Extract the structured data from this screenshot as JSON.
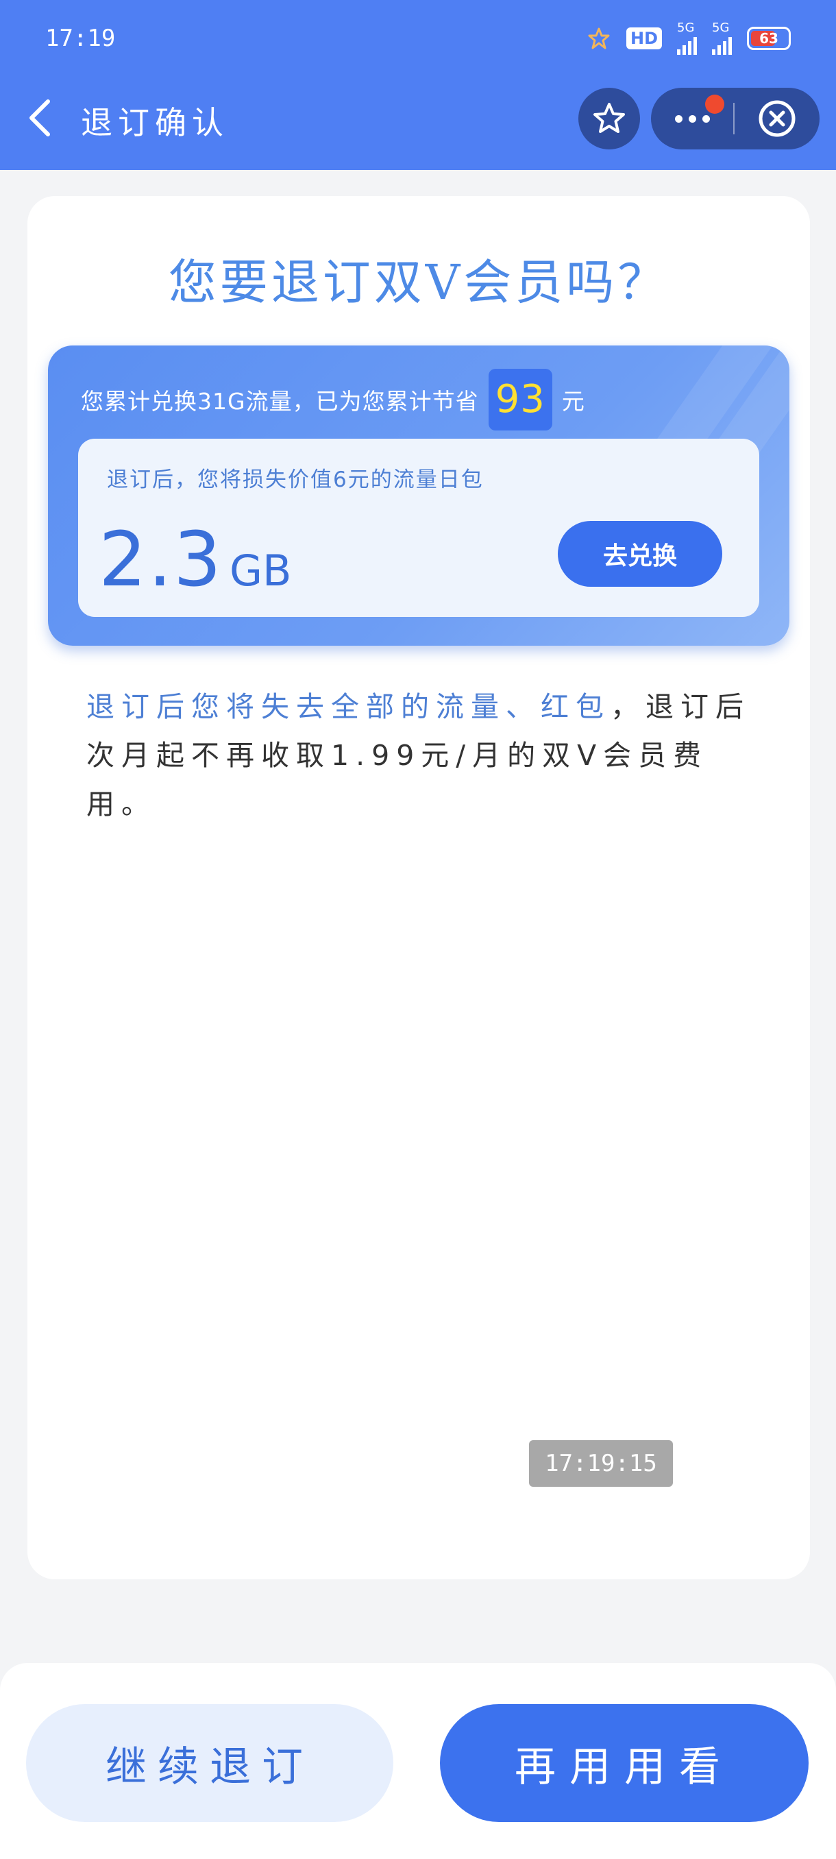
{
  "status_bar": {
    "time": "17:19",
    "hd_label": "HD",
    "network_1": "5G",
    "network_2": "5G",
    "battery_level": "63"
  },
  "nav": {
    "title": "退订确认",
    "icons": {
      "back": "back-arrow-icon",
      "favorite": "star-icon",
      "more": "more-dots-icon",
      "close": "close-circle-icon"
    }
  },
  "main": {
    "title": "您要退订双V会员吗？",
    "savings": {
      "prefix": "您累计兑换31G流量，已为您累计节省",
      "amount": "93",
      "suffix": "元"
    },
    "loss_notice": "退订后，您将损失价值6元的流量日包",
    "data_value": "2.3",
    "data_unit": "GB",
    "redeem_label": "去兑换",
    "description_highlight": "退订后您将失去全部的流量、红包",
    "description_rest": "，退订后次月起不再收取1.99元/月的双V会员费用。",
    "timestamp": "17:19:15"
  },
  "footer": {
    "continue_label": "继续退订",
    "keep_label": "再用用看"
  },
  "colors": {
    "header": "#4f7ff3",
    "accent": "#3c72ee",
    "highlight_number": "#ffe032",
    "notification_dot": "#ef4a2f"
  }
}
